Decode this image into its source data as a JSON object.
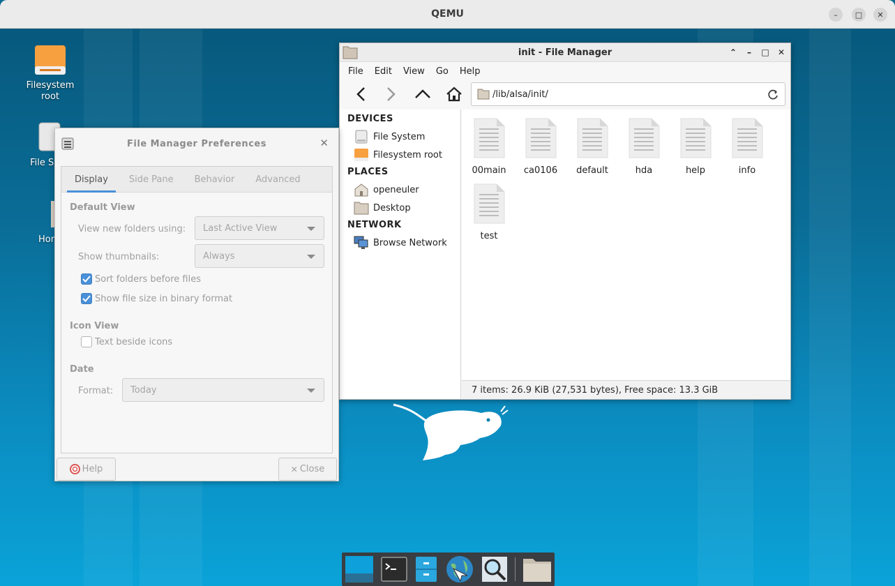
{
  "qemu": {
    "title": "QEMU",
    "minimize": "–",
    "maximize": "□",
    "close": "✕"
  },
  "desktop": {
    "icons": [
      {
        "label": "Filesystem root"
      },
      {
        "label": "File Sy"
      },
      {
        "label": "Hon"
      }
    ]
  },
  "file_manager": {
    "title": "init - File Manager",
    "menu": [
      "File",
      "Edit",
      "View",
      "Go",
      "Help"
    ],
    "location": "/lib/alsa/init/",
    "sidebar": {
      "devices_header": "DEVICES",
      "devices": [
        "File System",
        "Filesystem root"
      ],
      "places_header": "PLACES",
      "places": [
        "openeuler",
        "Desktop"
      ],
      "network_header": "NETWORK",
      "network": [
        "Browse Network"
      ]
    },
    "files": [
      "00main",
      "ca0106",
      "default",
      "hda",
      "help",
      "info",
      "test"
    ],
    "status": "7 items: 26.9 KiB (27,531 bytes), Free space: 13.3 GiB"
  },
  "preferences": {
    "title": "File Manager Preferences",
    "tabs": [
      "Display",
      "Side Pane",
      "Behavior",
      "Advanced"
    ],
    "default_view_header": "Default View",
    "view_new_folders_label": "View new folders using:",
    "view_new_folders_value": "Last Active View",
    "show_thumbnails_label": "Show thumbnails:",
    "show_thumbnails_value": "Always",
    "sort_folders": "Sort folders before files",
    "sort_folders_checked": true,
    "binary_size": "Show file size in binary format",
    "binary_size_checked": true,
    "icon_view_header": "Icon View",
    "text_beside_icons": "Text beside icons",
    "text_beside_icons_checked": false,
    "date_header": "Date",
    "format_label": "Format:",
    "format_value": "Today",
    "help_button": "Help",
    "close_button": "Close"
  },
  "colors": {
    "accent": "#4a90d9",
    "desktop": "#0b7fb0",
    "dock": "#3a3d41"
  }
}
